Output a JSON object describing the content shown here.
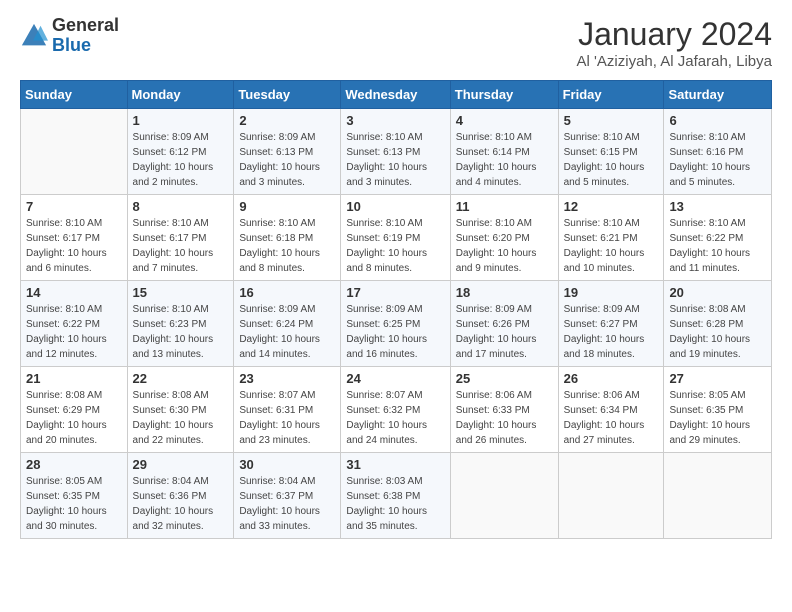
{
  "header": {
    "logo_general": "General",
    "logo_blue": "Blue",
    "title": "January 2024",
    "subtitle": "Al 'Aziziyah, Al Jafarah, Libya"
  },
  "calendar": {
    "days_of_week": [
      "Sunday",
      "Monday",
      "Tuesday",
      "Wednesday",
      "Thursday",
      "Friday",
      "Saturday"
    ],
    "weeks": [
      [
        {
          "day": "",
          "sunrise": "",
          "sunset": "",
          "daylight": ""
        },
        {
          "day": "1",
          "sunrise": "Sunrise: 8:09 AM",
          "sunset": "Sunset: 6:12 PM",
          "daylight": "Daylight: 10 hours and 2 minutes."
        },
        {
          "day": "2",
          "sunrise": "Sunrise: 8:09 AM",
          "sunset": "Sunset: 6:13 PM",
          "daylight": "Daylight: 10 hours and 3 minutes."
        },
        {
          "day": "3",
          "sunrise": "Sunrise: 8:10 AM",
          "sunset": "Sunset: 6:13 PM",
          "daylight": "Daylight: 10 hours and 3 minutes."
        },
        {
          "day": "4",
          "sunrise": "Sunrise: 8:10 AM",
          "sunset": "Sunset: 6:14 PM",
          "daylight": "Daylight: 10 hours and 4 minutes."
        },
        {
          "day": "5",
          "sunrise": "Sunrise: 8:10 AM",
          "sunset": "Sunset: 6:15 PM",
          "daylight": "Daylight: 10 hours and 5 minutes."
        },
        {
          "day": "6",
          "sunrise": "Sunrise: 8:10 AM",
          "sunset": "Sunset: 6:16 PM",
          "daylight": "Daylight: 10 hours and 5 minutes."
        }
      ],
      [
        {
          "day": "7",
          "sunrise": "Sunrise: 8:10 AM",
          "sunset": "Sunset: 6:17 PM",
          "daylight": "Daylight: 10 hours and 6 minutes."
        },
        {
          "day": "8",
          "sunrise": "Sunrise: 8:10 AM",
          "sunset": "Sunset: 6:17 PM",
          "daylight": "Daylight: 10 hours and 7 minutes."
        },
        {
          "day": "9",
          "sunrise": "Sunrise: 8:10 AM",
          "sunset": "Sunset: 6:18 PM",
          "daylight": "Daylight: 10 hours and 8 minutes."
        },
        {
          "day": "10",
          "sunrise": "Sunrise: 8:10 AM",
          "sunset": "Sunset: 6:19 PM",
          "daylight": "Daylight: 10 hours and 8 minutes."
        },
        {
          "day": "11",
          "sunrise": "Sunrise: 8:10 AM",
          "sunset": "Sunset: 6:20 PM",
          "daylight": "Daylight: 10 hours and 9 minutes."
        },
        {
          "day": "12",
          "sunrise": "Sunrise: 8:10 AM",
          "sunset": "Sunset: 6:21 PM",
          "daylight": "Daylight: 10 hours and 10 minutes."
        },
        {
          "day": "13",
          "sunrise": "Sunrise: 8:10 AM",
          "sunset": "Sunset: 6:22 PM",
          "daylight": "Daylight: 10 hours and 11 minutes."
        }
      ],
      [
        {
          "day": "14",
          "sunrise": "Sunrise: 8:10 AM",
          "sunset": "Sunset: 6:22 PM",
          "daylight": "Daylight: 10 hours and 12 minutes."
        },
        {
          "day": "15",
          "sunrise": "Sunrise: 8:10 AM",
          "sunset": "Sunset: 6:23 PM",
          "daylight": "Daylight: 10 hours and 13 minutes."
        },
        {
          "day": "16",
          "sunrise": "Sunrise: 8:09 AM",
          "sunset": "Sunset: 6:24 PM",
          "daylight": "Daylight: 10 hours and 14 minutes."
        },
        {
          "day": "17",
          "sunrise": "Sunrise: 8:09 AM",
          "sunset": "Sunset: 6:25 PM",
          "daylight": "Daylight: 10 hours and 16 minutes."
        },
        {
          "day": "18",
          "sunrise": "Sunrise: 8:09 AM",
          "sunset": "Sunset: 6:26 PM",
          "daylight": "Daylight: 10 hours and 17 minutes."
        },
        {
          "day": "19",
          "sunrise": "Sunrise: 8:09 AM",
          "sunset": "Sunset: 6:27 PM",
          "daylight": "Daylight: 10 hours and 18 minutes."
        },
        {
          "day": "20",
          "sunrise": "Sunrise: 8:08 AM",
          "sunset": "Sunset: 6:28 PM",
          "daylight": "Daylight: 10 hours and 19 minutes."
        }
      ],
      [
        {
          "day": "21",
          "sunrise": "Sunrise: 8:08 AM",
          "sunset": "Sunset: 6:29 PM",
          "daylight": "Daylight: 10 hours and 20 minutes."
        },
        {
          "day": "22",
          "sunrise": "Sunrise: 8:08 AM",
          "sunset": "Sunset: 6:30 PM",
          "daylight": "Daylight: 10 hours and 22 minutes."
        },
        {
          "day": "23",
          "sunrise": "Sunrise: 8:07 AM",
          "sunset": "Sunset: 6:31 PM",
          "daylight": "Daylight: 10 hours and 23 minutes."
        },
        {
          "day": "24",
          "sunrise": "Sunrise: 8:07 AM",
          "sunset": "Sunset: 6:32 PM",
          "daylight": "Daylight: 10 hours and 24 minutes."
        },
        {
          "day": "25",
          "sunrise": "Sunrise: 8:06 AM",
          "sunset": "Sunset: 6:33 PM",
          "daylight": "Daylight: 10 hours and 26 minutes."
        },
        {
          "day": "26",
          "sunrise": "Sunrise: 8:06 AM",
          "sunset": "Sunset: 6:34 PM",
          "daylight": "Daylight: 10 hours and 27 minutes."
        },
        {
          "day": "27",
          "sunrise": "Sunrise: 8:05 AM",
          "sunset": "Sunset: 6:35 PM",
          "daylight": "Daylight: 10 hours and 29 minutes."
        }
      ],
      [
        {
          "day": "28",
          "sunrise": "Sunrise: 8:05 AM",
          "sunset": "Sunset: 6:35 PM",
          "daylight": "Daylight: 10 hours and 30 minutes."
        },
        {
          "day": "29",
          "sunrise": "Sunrise: 8:04 AM",
          "sunset": "Sunset: 6:36 PM",
          "daylight": "Daylight: 10 hours and 32 minutes."
        },
        {
          "day": "30",
          "sunrise": "Sunrise: 8:04 AM",
          "sunset": "Sunset: 6:37 PM",
          "daylight": "Daylight: 10 hours and 33 minutes."
        },
        {
          "day": "31",
          "sunrise": "Sunrise: 8:03 AM",
          "sunset": "Sunset: 6:38 PM",
          "daylight": "Daylight: 10 hours and 35 minutes."
        },
        {
          "day": "",
          "sunrise": "",
          "sunset": "",
          "daylight": ""
        },
        {
          "day": "",
          "sunrise": "",
          "sunset": "",
          "daylight": ""
        },
        {
          "day": "",
          "sunrise": "",
          "sunset": "",
          "daylight": ""
        }
      ]
    ]
  }
}
